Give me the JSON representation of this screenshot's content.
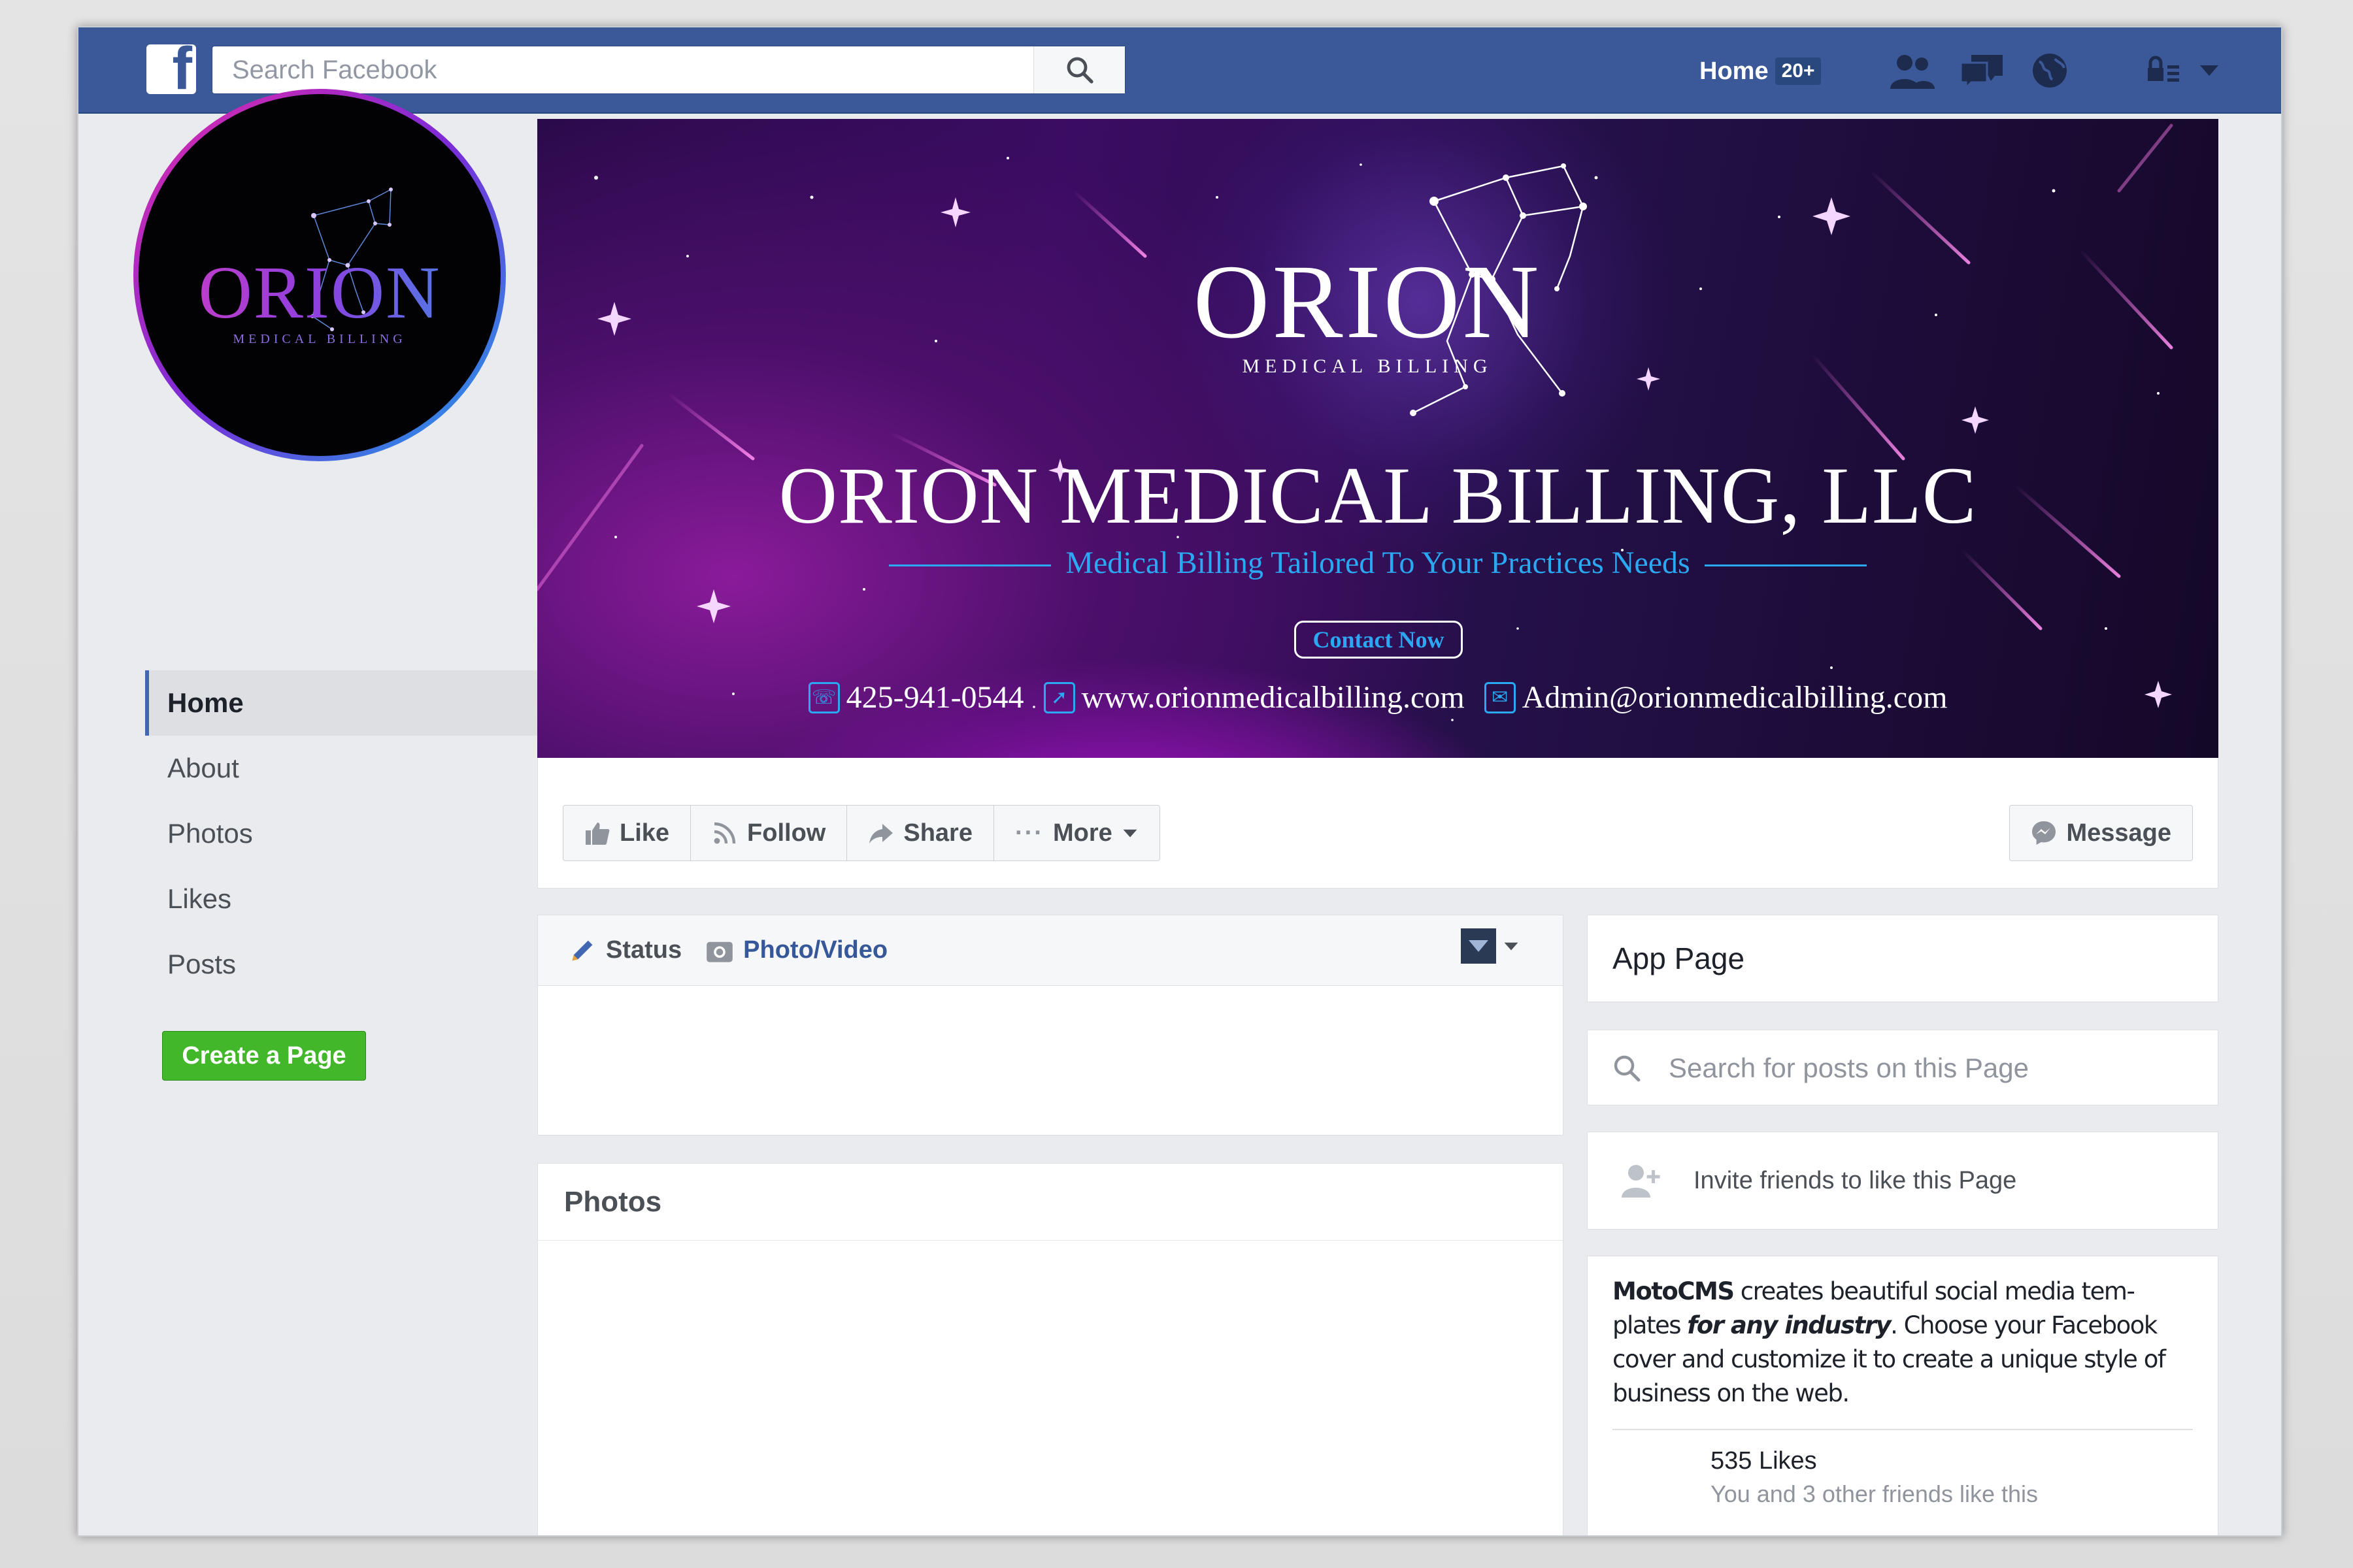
{
  "topbar": {
    "logo": "f",
    "search_placeholder": "Search Facebook",
    "home_label": "Home",
    "home_badge": "20+"
  },
  "sidebar": {
    "profile_logo_main": "ORION",
    "profile_logo_sub": "MEDICAL BILLING",
    "items": [
      {
        "label": "Home",
        "active": true
      },
      {
        "label": "About"
      },
      {
        "label": "Photos"
      },
      {
        "label": "Likes"
      },
      {
        "label": "Posts"
      }
    ],
    "create_page_label": "Create a Page"
  },
  "cover": {
    "logo_main": "ORION",
    "logo_sub": "MEDICAL BILLING",
    "title": "ORION MEDICAL BILLING, LLC",
    "tagline": "Medical Billing Tailored To Your Practices Needs",
    "contact_button": "Contact Now",
    "phone": "425-941-0544",
    "website": "www.orionmedicalbilling.com",
    "email": "Admin@orionmedicalbilling.com",
    "colors": {
      "accent": "#2aa8f2"
    }
  },
  "actions": {
    "like": "Like",
    "follow": "Follow",
    "share": "Share",
    "more": "More",
    "message": "Message"
  },
  "composer": {
    "status_tab": "Status",
    "photo_tab": "Photo/Video"
  },
  "photos": {
    "title": "Photos"
  },
  "right": {
    "app_page": "App Page",
    "search_placeholder": "Search for posts on this Page",
    "invite": "Invite friends to like this Page",
    "promo_brand": "MotoCMS",
    "promo_line1": " creates beautiful social media tem-",
    "promo_line2a": "plates ",
    "promo_emph": "for any industry",
    "promo_line2b": ". Choose your Facebook",
    "promo_line3": "cover and customize it to create a unique style of",
    "promo_line4": "business on the web.",
    "likes_count": "535 Likes",
    "likes_friends": "You and 3 other friends like this"
  },
  "colors": {
    "facebook_blue": "#3b5998",
    "create_green": "#42b72a",
    "background": "#e9ebee"
  }
}
